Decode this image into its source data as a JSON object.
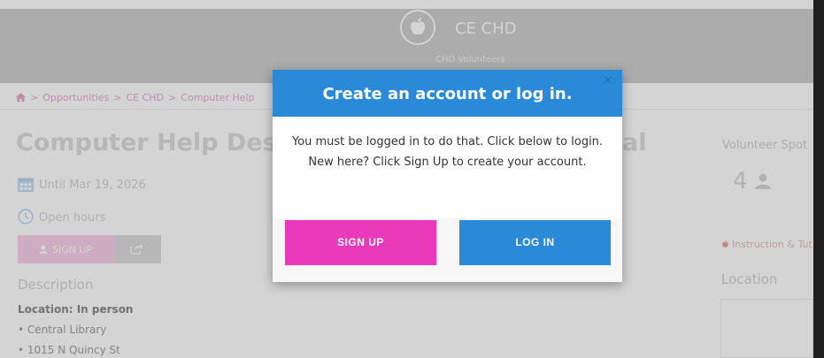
{
  "header": {
    "org_name": "CE CHD",
    "org_subtitle": "CHD Volunteers",
    "logo_icon": "apple-icon"
  },
  "breadcrumb": {
    "items": [
      "Opportunities",
      "CE CHD",
      "Computer Help"
    ]
  },
  "opportunity": {
    "title": "Computer Help Des",
    "title_tail": "al",
    "date": "Until Mar 19, 2026",
    "hours": "Open hours",
    "signup_label": "SIGN UP",
    "description_heading": "Description",
    "location_label": "Location: In person",
    "location_items": [
      "• Central Library",
      "• 1015 N Quincy St"
    ]
  },
  "sidebar": {
    "spots_heading": "Volunteer Spot",
    "spots_count": "4",
    "category": "Instruction & Tut",
    "location_heading": "Location"
  },
  "modal": {
    "title": "Create an account or log in.",
    "close_symbol": "×",
    "message": "You must be logged in to do that. Click below to login. New here? Click Sign Up to create your account.",
    "signup_button": "SIGN UP",
    "login_button": "LOG IN"
  },
  "colors": {
    "primary_blue": "#2b8ad8",
    "signup_pink": "#e83ab9"
  }
}
